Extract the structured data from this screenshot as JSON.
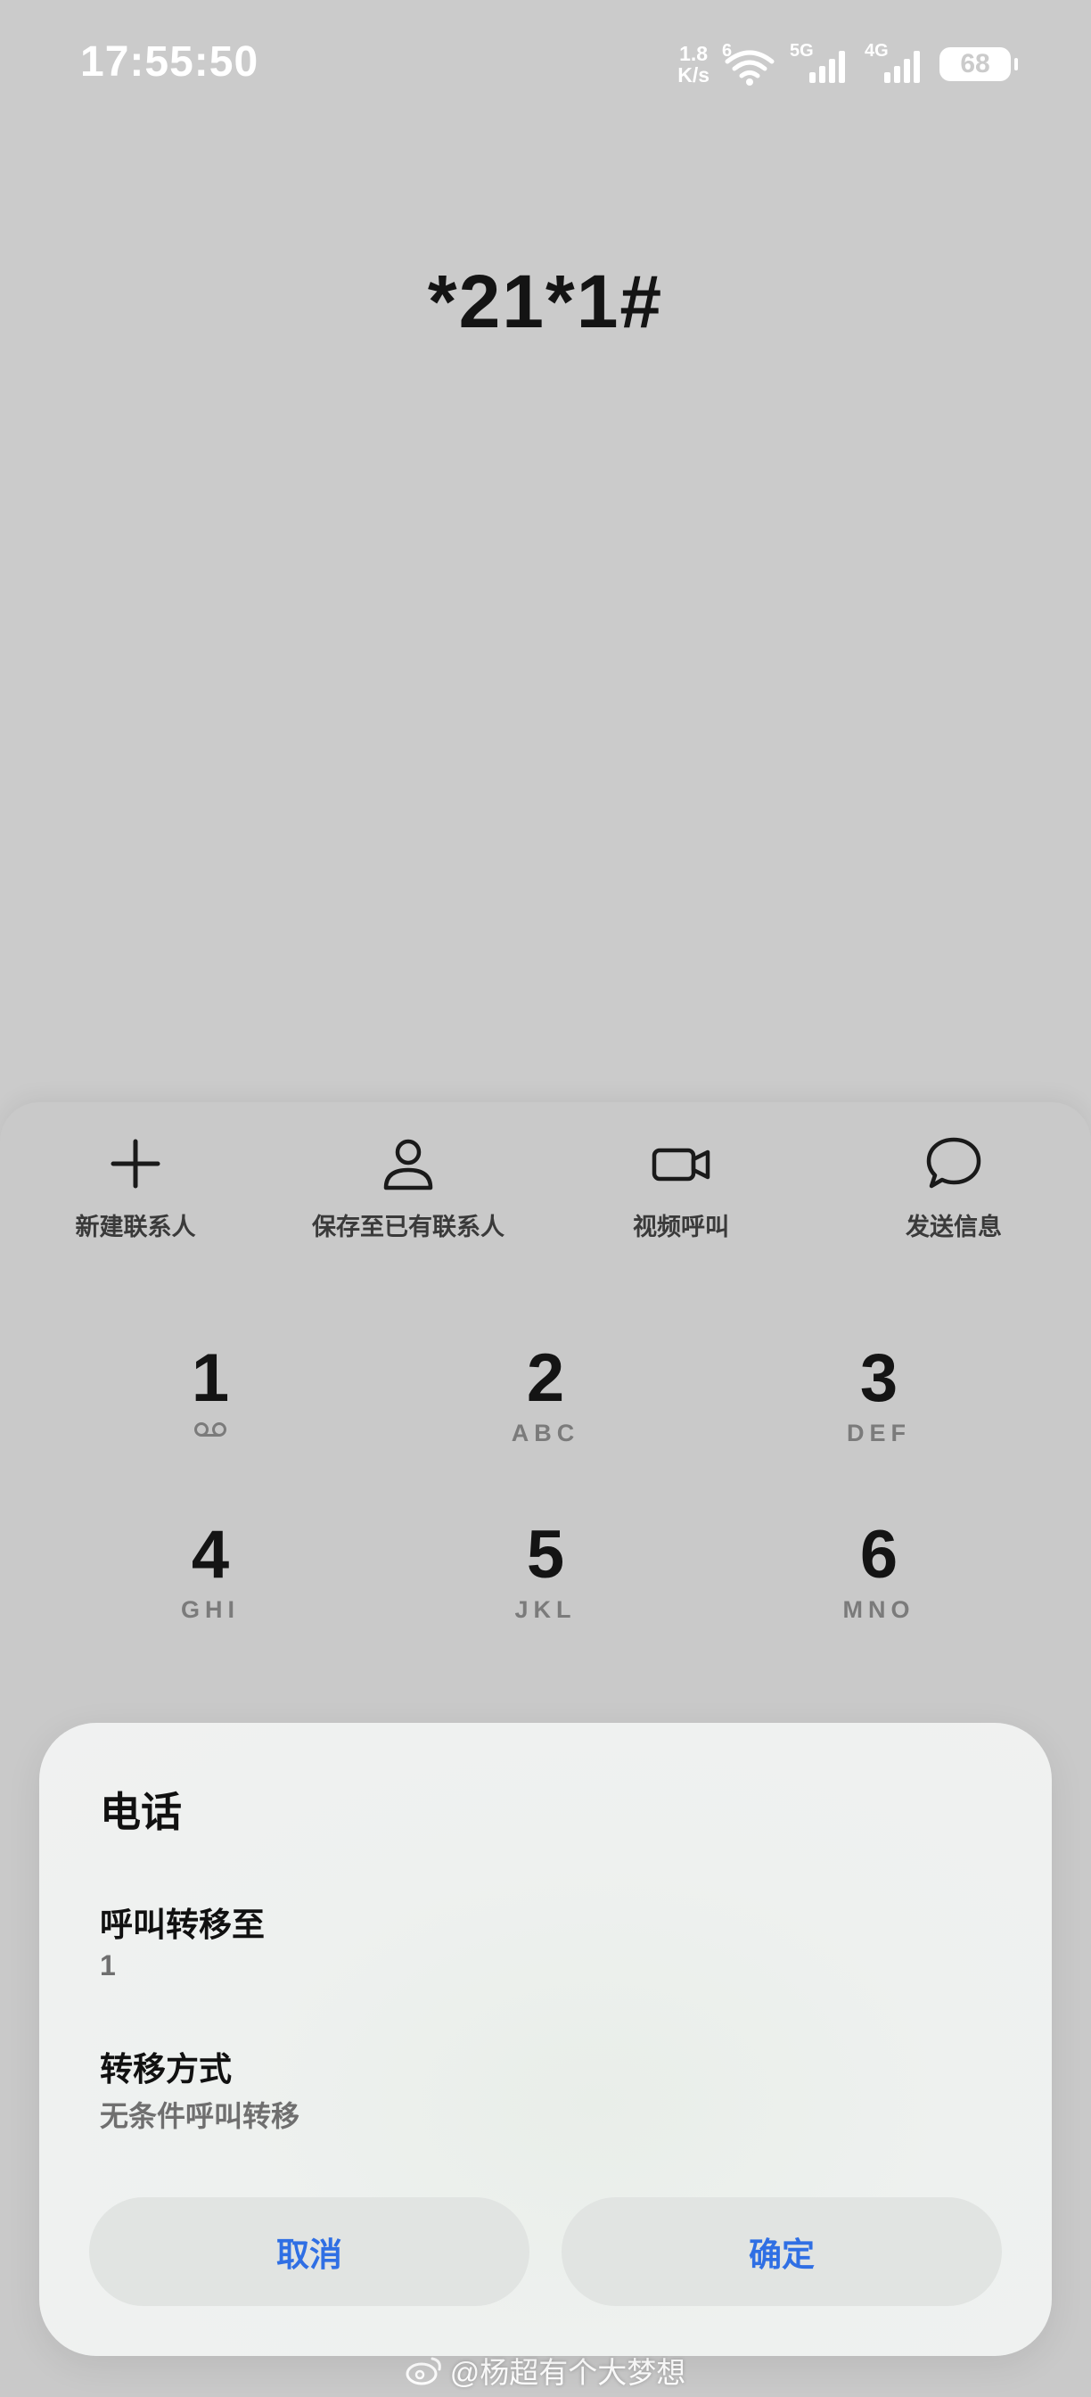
{
  "status_bar": {
    "time": "17:55:50",
    "net_speed_value": "1.8",
    "net_speed_unit": "K/s",
    "wifi_tag": "6",
    "sim1_tag": "5G",
    "sim2_tag": "4G",
    "battery": "68",
    "icons": [
      "wifi-icon",
      "signal-5g-icon",
      "signal-4g-icon",
      "battery-icon"
    ]
  },
  "dialed_number": "*21*1#",
  "actions": [
    {
      "label": "新建联系人",
      "icon": "plus-icon"
    },
    {
      "label": "保存至已有联系人",
      "icon": "person-icon"
    },
    {
      "label": "视频呼叫",
      "icon": "video-camera-icon"
    },
    {
      "label": "发送信息",
      "icon": "chat-bubble-icon"
    }
  ],
  "keypad": [
    {
      "digit": "1",
      "letters": ""
    },
    {
      "digit": "2",
      "letters": "ABC"
    },
    {
      "digit": "3",
      "letters": "DEF"
    },
    {
      "digit": "4",
      "letters": "GHI"
    },
    {
      "digit": "5",
      "letters": "JKL"
    },
    {
      "digit": "6",
      "letters": "MNO"
    }
  ],
  "dialog": {
    "title": "电话",
    "forward_to_label": "呼叫转移至",
    "forward_to_value": "1",
    "mode_label": "转移方式",
    "mode_value": "无条件呼叫转移",
    "cancel_label": "取消",
    "confirm_label": "确定"
  },
  "watermark": "@杨超有个大梦想",
  "colors": {
    "background": "#cbcbcb",
    "dialog_button_text": "#2f6fe4",
    "nav_active": "#3fae5a"
  }
}
